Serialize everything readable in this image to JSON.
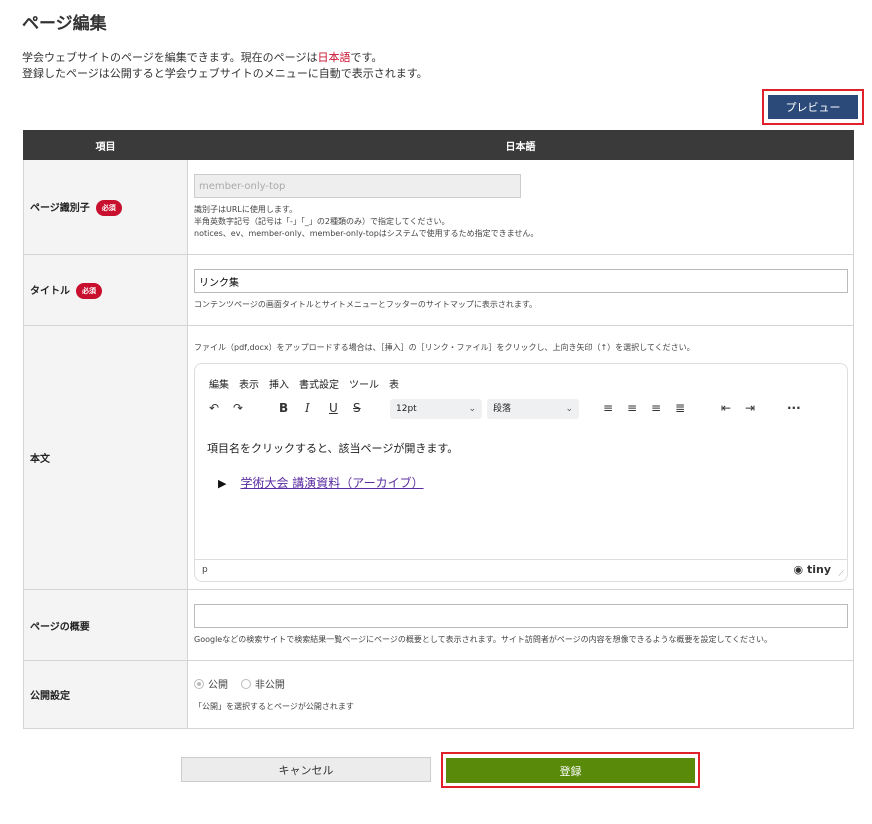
{
  "page": {
    "title": "ページ編集",
    "desc_line1_a": "学会ウェブサイトのページを編集できます。現在のページは",
    "desc_line1_lang": "日本語",
    "desc_line1_b": "です。",
    "desc_line2": "登録したページは公開すると学会ウェブサイトのメニューに自動で表示されます。",
    "preview_label": "プレビュー"
  },
  "table": {
    "col_item": "項目",
    "col_lang": "日本語"
  },
  "required_badge": "必須",
  "identifier": {
    "label": "ページ識別子",
    "value": "member-only-top",
    "hint1": "識別子はURLに使用します。",
    "hint2": "半角英数字記号（記号は「-」「_」の2種類のみ）で指定してください。",
    "hint3": "notices、ev、member-only、member-only-topはシステムで使用するため指定できません。"
  },
  "title_field": {
    "label": "タイトル",
    "value": "リンク集",
    "hint": "コンテンツページの画面タイトルとサイトメニューとフッターのサイトマップに表示されます。"
  },
  "body": {
    "label": "本文",
    "hint": "ファイル（pdf,docx）をアップロードする場合は、［挿入］の［リンク・ファイル］をクリックし、上向き矢印（↑）を選択してください。",
    "menu": [
      "編集",
      "表示",
      "挿入",
      "書式設定",
      "ツール",
      "表"
    ],
    "font_size": "12pt",
    "block_format": "段落",
    "content_text": "項目名をクリックすると、該当ページが開きます。",
    "link_text": "学術大会 講演資料（アーカイブ）",
    "status_path": "p",
    "brand": "tiny"
  },
  "summary": {
    "label": "ページの概要",
    "value": "",
    "hint": "Googleなどの検索サイトで検索結果一覧ページにページの概要として表示されます。サイト訪問者がページの内容を想像できるような概要を設定してください。"
  },
  "publish": {
    "label": "公開設定",
    "option_public": "公開",
    "option_private": "非公開",
    "selected": "公開",
    "hint": "「公開」を選択するとページが公開されます"
  },
  "actions": {
    "cancel_label": "キャンセル",
    "submit_label": "登録"
  },
  "colors": {
    "header_bg": "#3a3a3a",
    "preview_btn": "#2b4a7a",
    "submit_btn": "#5a8a0a",
    "required": "#c8102e",
    "highlight_border": "#e0202a"
  }
}
